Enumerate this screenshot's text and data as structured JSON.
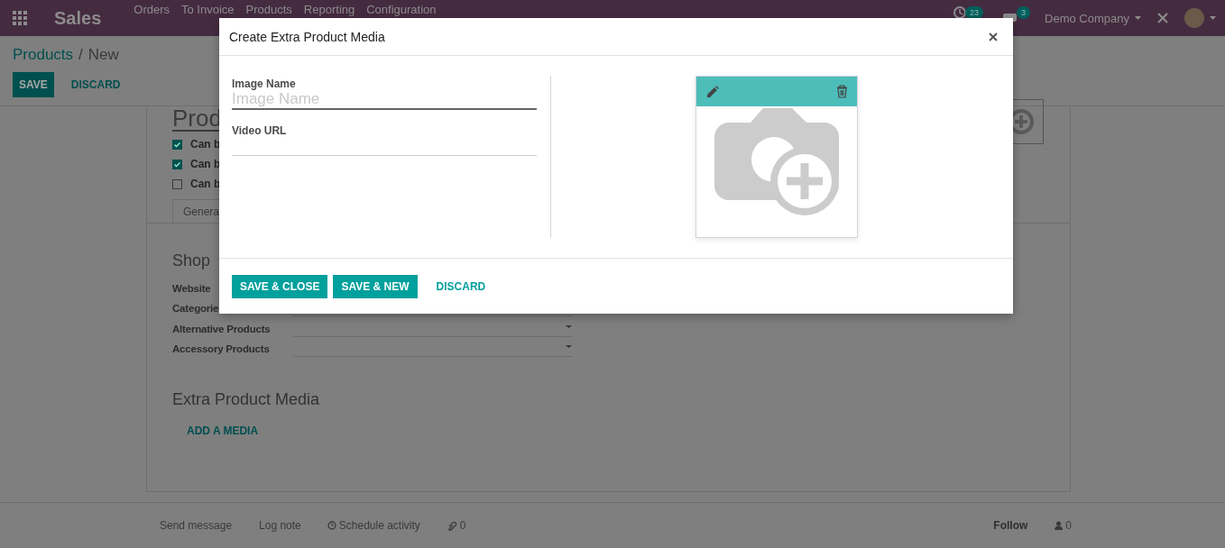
{
  "navbar": {
    "app": "Sales",
    "menu": [
      "Orders",
      "To Invoice",
      "Products",
      "Reporting",
      "Configuration"
    ],
    "activity_count": "23",
    "message_count": "3",
    "company": "Demo Company"
  },
  "breadcrumb": {
    "parent": "Products",
    "separator": "/",
    "current": "New"
  },
  "control_buttons": [
    {
      "label": "SAVE",
      "kind": "primary"
    },
    {
      "label": "DISCARD",
      "kind": "link"
    }
  ],
  "form": {
    "title": "Prod",
    "options": [
      {
        "label": "Can b",
        "checked": true
      },
      {
        "label": "Can b",
        "checked": true
      },
      {
        "label": "Can b",
        "checked": false
      }
    ],
    "tabs": [
      {
        "label": "Genera",
        "selected": true
      }
    ],
    "shop": {
      "heading": "Shop",
      "fields": [
        {
          "label": "Website",
          "kind": "label"
        },
        {
          "label": "Categorie",
          "kind": "line"
        },
        {
          "label": "Alternative Products",
          "kind": "dropdown"
        },
        {
          "label": "Accessory Products",
          "kind": "dropdown"
        }
      ]
    },
    "media": {
      "heading": "Extra Product Media",
      "add_link": "ADD A MEDIA"
    }
  },
  "chatter": {
    "actions": [
      "Send message",
      "Log note",
      "Schedule activity"
    ],
    "attachments": "0",
    "follow": "Follow",
    "followers": "0"
  },
  "dialog": {
    "title": "Create Extra Product Media",
    "fields": [
      {
        "label": "Image Name",
        "placeholder": "Image Name",
        "focused": true
      },
      {
        "label": "Video URL",
        "focused": false
      }
    ],
    "buttons": [
      {
        "label": "SAVE & CLOSE",
        "kind": "primary"
      },
      {
        "label": "SAVE & NEW",
        "kind": "primary"
      },
      {
        "label": "DISCARD",
        "kind": "link"
      }
    ]
  }
}
